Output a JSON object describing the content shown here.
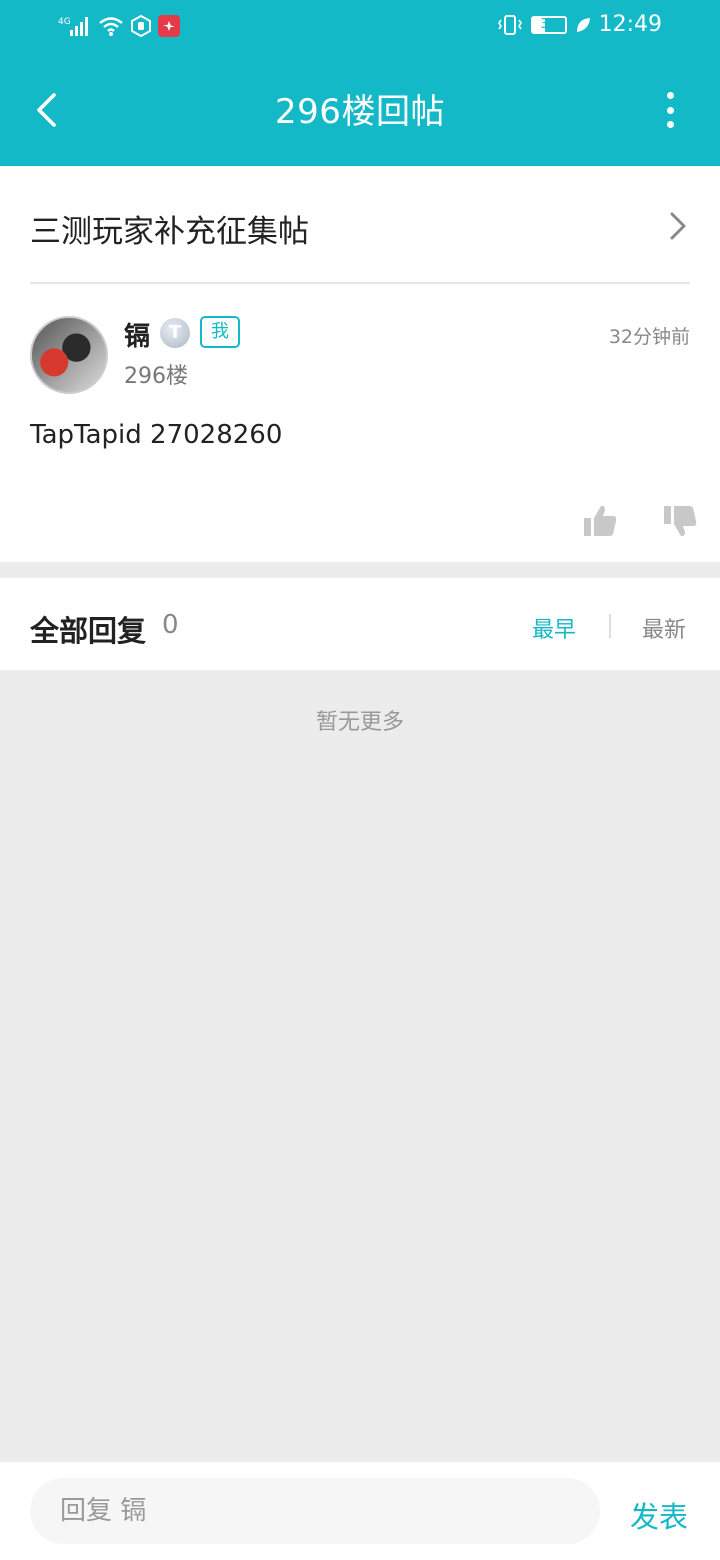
{
  "status_bar": {
    "network": "4G",
    "battery_level": "37",
    "time": "12:49"
  },
  "header": {
    "title": "296楼回帖"
  },
  "thread": {
    "title": "三测玩家补充征集帖"
  },
  "post": {
    "author": "镉",
    "level_badge": "T",
    "me_tag": "我",
    "floor": "296楼",
    "time": "32分钟前",
    "content": "TapTapid 27028260"
  },
  "replies": {
    "title": "全部回复",
    "count": "0",
    "sort_earliest": "最早",
    "sort_latest": "最新",
    "empty_text": "暂无更多"
  },
  "reply_bar": {
    "placeholder": "回复 镉",
    "send_label": "发表"
  },
  "colors": {
    "accent": "#14b9c8",
    "background": "#ececec"
  }
}
